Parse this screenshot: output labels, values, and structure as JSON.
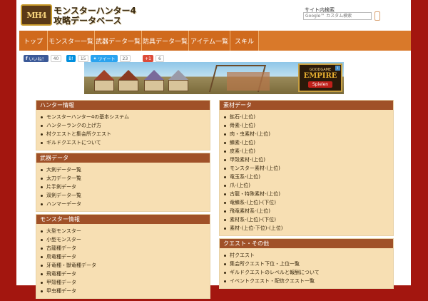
{
  "header": {
    "logo_text": "MH4",
    "title_line1": "モンスターハンター4",
    "title_line2": "攻略データベース",
    "search_label": "サイト内検索",
    "search_placeholder": "Google™ カスタム検索"
  },
  "nav": {
    "items": [
      {
        "label": "トップ",
        "w": 40
      },
      {
        "label": "モンスター一覧",
        "w": 66
      },
      {
        "label": "武器データ一覧",
        "w": 66
      },
      {
        "label": "防具データ一覧",
        "w": 66
      },
      {
        "label": "アイテム一覧",
        "w": 58
      },
      {
        "label": "スキル",
        "w": 40
      }
    ]
  },
  "social": {
    "facebook_label": "いいね！",
    "facebook_count": "40",
    "hatena_count": "15",
    "tweet_label": "ツイート",
    "tweet_count": "23",
    "gplus_label": "+1",
    "gplus_count": "6"
  },
  "banner": {
    "ad_small": "GOODGAME",
    "ad_big": "EMPIRE",
    "ad_button": "Spielen"
  },
  "left_boxes": [
    {
      "title": "ハンター情報",
      "items": [
        "モンスターハンター4の基本システム",
        "ハンターランクの上げ方",
        "村クエストと集会所クエスト",
        "ギルドクエストについて"
      ]
    },
    {
      "title": "武器データ",
      "items": [
        "大剣データ一覧",
        "太刀データ一覧",
        "片手剣データ",
        "双剣データ一覧",
        "ハンマーデータ"
      ]
    },
    {
      "title": "モンスター情報",
      "items": [
        "大型モンスター",
        "小型モンスター",
        "古龍種データ",
        "鳥竜種データ",
        "牙竜種・獣竜種データ",
        "飛竜種データ",
        "甲殻種データ",
        "甲虫種データ"
      ]
    }
  ],
  "right_boxes": [
    {
      "title": "素材データ",
      "items": [
        "鉱石-(上位)",
        "骨素-(上位)",
        "肉・虫素材-(上位)",
        "鱗素-(上位)",
        "皮素-(上位)",
        "甲殻素材-(上位)",
        "モンスター素材-(上位)",
        "竜玉系-(上位)",
        "爪-(上位)",
        "古龍・特殊素材-(上位)",
        "竜鱗系-(上位)-(下位)",
        "飛竜素材系-(上位)",
        "素材系-(上位)-(下位)",
        "素材-(上位-下位)-(上位)"
      ]
    },
    {
      "title": "クエスト・その他",
      "items": [
        "村クエスト",
        "集会所クエスト下位・上位一覧",
        "ギルドクエストのレベルと報酬について",
        "イベントクエスト・配信クエスト一覧"
      ]
    }
  ]
}
